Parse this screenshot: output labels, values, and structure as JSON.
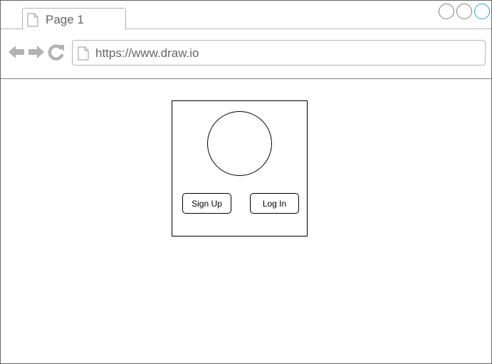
{
  "browser": {
    "tab": {
      "label": "Page 1",
      "icon": "document-icon"
    },
    "window_controls": [
      "minimize-icon",
      "maximize-icon",
      "close-icon"
    ],
    "nav": {
      "back_icon": "back-arrow-icon",
      "forward_icon": "forward-arrow-icon",
      "reload_icon": "reload-icon"
    },
    "address": {
      "url": "https://www.draw.io",
      "icon": "document-icon"
    }
  },
  "main": {
    "login_card": {
      "avatar_icon": "avatar-circle",
      "signup_label": "Sign Up",
      "login_label": "Log In"
    }
  },
  "colors": {
    "chrome_gray": "#b3b3b3",
    "text_gray": "#666666",
    "active_control": "#2aa0d3",
    "wire_black": "#000000"
  }
}
